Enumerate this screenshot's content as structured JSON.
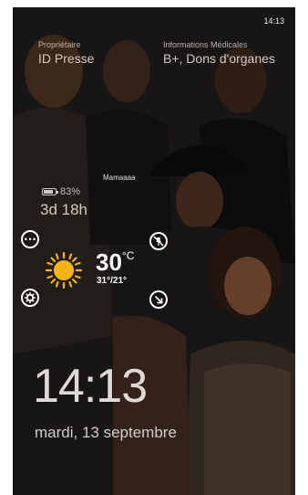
{
  "status_bar": {
    "time": "14:13"
  },
  "owner": {
    "label": "Propriétaire",
    "value": "ID Presse"
  },
  "medical": {
    "label": "Informations Médicales",
    "value": "B+, Dons d'organes"
  },
  "caption": "Mamaaaa",
  "battery": {
    "percent": "83%",
    "uptime": "3d 18h"
  },
  "weather": {
    "temperature": "30",
    "unit": "°C",
    "minmax": "31°/21°",
    "icon": "sun-icon"
  },
  "lock_screen": {
    "time": "14:13",
    "date": "mardi, 13 septembre"
  },
  "colors": {
    "sun": "#f6b21b",
    "text": "#ffffff"
  }
}
